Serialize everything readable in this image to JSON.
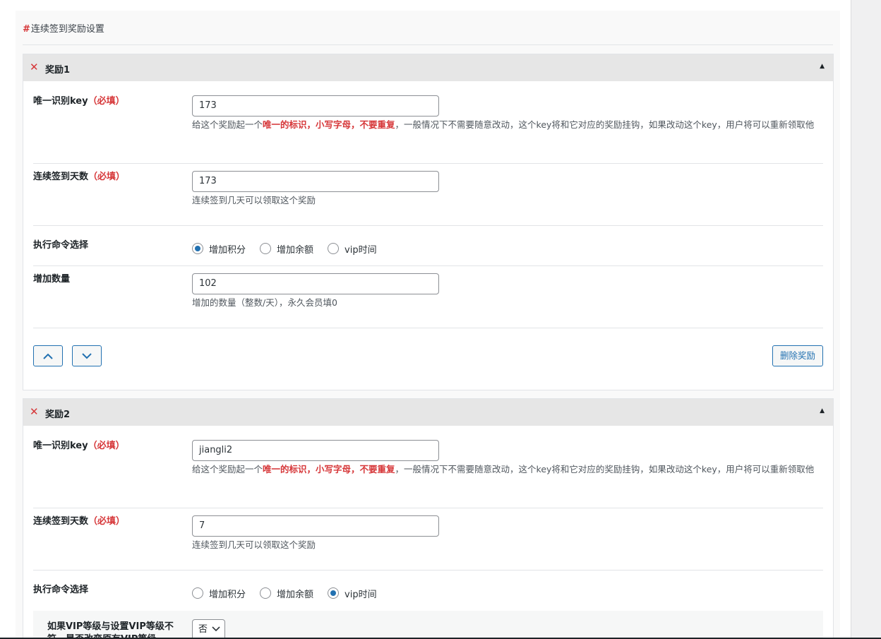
{
  "section": {
    "hash": "#",
    "title": "连续签到奖励设置"
  },
  "groups": [
    {
      "title": "奖励1",
      "key_label": "唯一识别key",
      "required": "（必填）",
      "key_value": "173",
      "key_desc_pre": "给这个奖励起一个",
      "key_desc_em": "唯一的标识，小写字母，不要重复",
      "key_desc_post": "，一般情况下不需要随意改动，这个key将和它对应的奖励挂钩，如果改动这个key，用户将可以重新领取他",
      "days_label": "连续签到天数",
      "days_value": "173",
      "days_desc": "连续签到几天可以领取这个奖励",
      "cmd_label": "执行命令选择",
      "options": [
        "增加积分",
        "增加余额",
        "vip时间"
      ],
      "selected": 0,
      "amount_label": "增加数量",
      "amount_value": "102",
      "amount_desc": "增加的数量（整数/天），永久会员填0",
      "delete_label": "删除奖励"
    },
    {
      "title": "奖励2",
      "key_label": "唯一识别key",
      "required": "（必填）",
      "key_value": "jiangli2",
      "key_desc_pre": "给这个奖励起一个",
      "key_desc_em": "唯一的标识，小写字母，不要重复",
      "key_desc_post": "，一般情况下不需要随意改动，这个key将和它对应的奖励挂钩，如果改动这个key，用户将可以重新领取他",
      "days_label": "连续签到天数",
      "days_value": "7",
      "days_desc": "连续签到几天可以领取这个奖励",
      "cmd_label": "执行命令选择",
      "options": [
        "增加积分",
        "增加余额",
        "vip时间"
      ],
      "selected": 2,
      "vip_label": "如果VIP等级与设置VIP等级不符，是否改变原有VIP等级",
      "vip_select": "否"
    }
  ]
}
